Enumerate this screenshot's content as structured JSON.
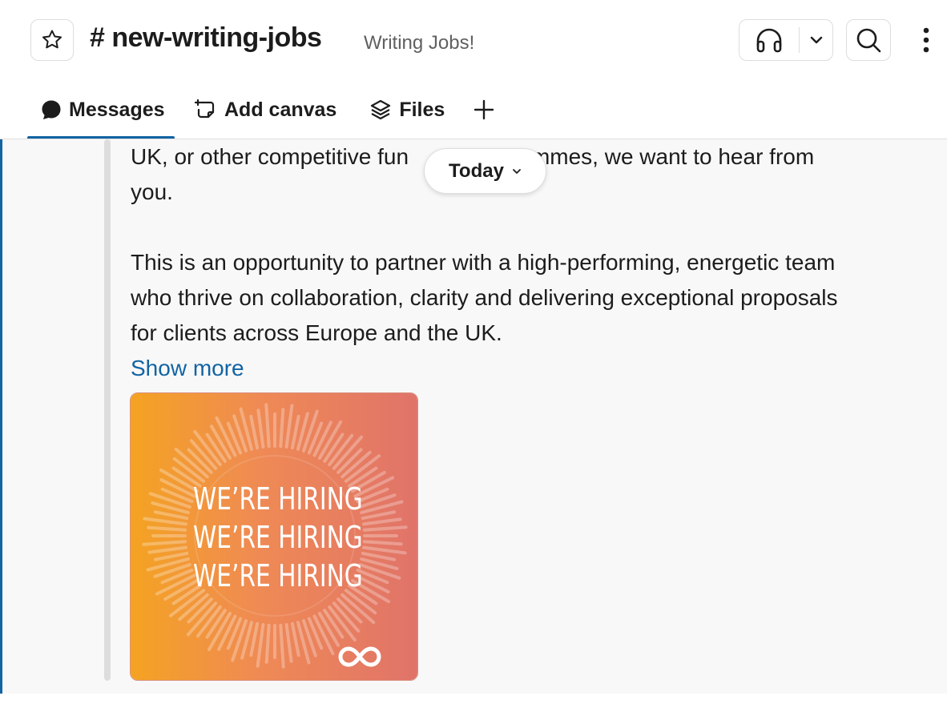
{
  "header": {
    "channel_name": "# new-writing-jobs",
    "channel_topic": "Writing Jobs!"
  },
  "icons": {
    "star": "star-icon",
    "headphones": "headphones-icon",
    "chevron": "chevron-down-icon",
    "search": "search-icon",
    "more": "kebab-icon",
    "messages": "message-bubble-icon",
    "canvas": "canvas-icon",
    "files": "layers-icon",
    "add": "plus-icon",
    "logo": "infinity-logo"
  },
  "tabs": [
    {
      "label": "Messages",
      "active": true
    },
    {
      "label": "Add canvas",
      "active": false
    },
    {
      "label": "Files",
      "active": false
    }
  ],
  "date_pill": {
    "label": "Today"
  },
  "message": {
    "line1_start": "UK, or other competitive fun",
    "line1_end": "rammes, we want to hear from",
    "line2": "you.",
    "paragraph2_line1": "This is an opportunity to partner with a high-performing, energetic team",
    "paragraph2_line2": "who thrive on collaboration, clarity and delivering exceptional proposals",
    "paragraph2_line3": "for clients across Europe and the UK.",
    "show_more": "Show more"
  },
  "attachment": {
    "lines": [
      "WE’RE HIRING",
      "WE’RE HIRING",
      "WE’RE HIRING"
    ],
    "colors": {
      "left": "#f4a12a",
      "mid": "#ef8a5a",
      "right": "#e07468"
    }
  },
  "colors": {
    "accent": "#1264a3",
    "text": "#1d1c1d",
    "muted": "#616061",
    "border": "#dddddd"
  }
}
